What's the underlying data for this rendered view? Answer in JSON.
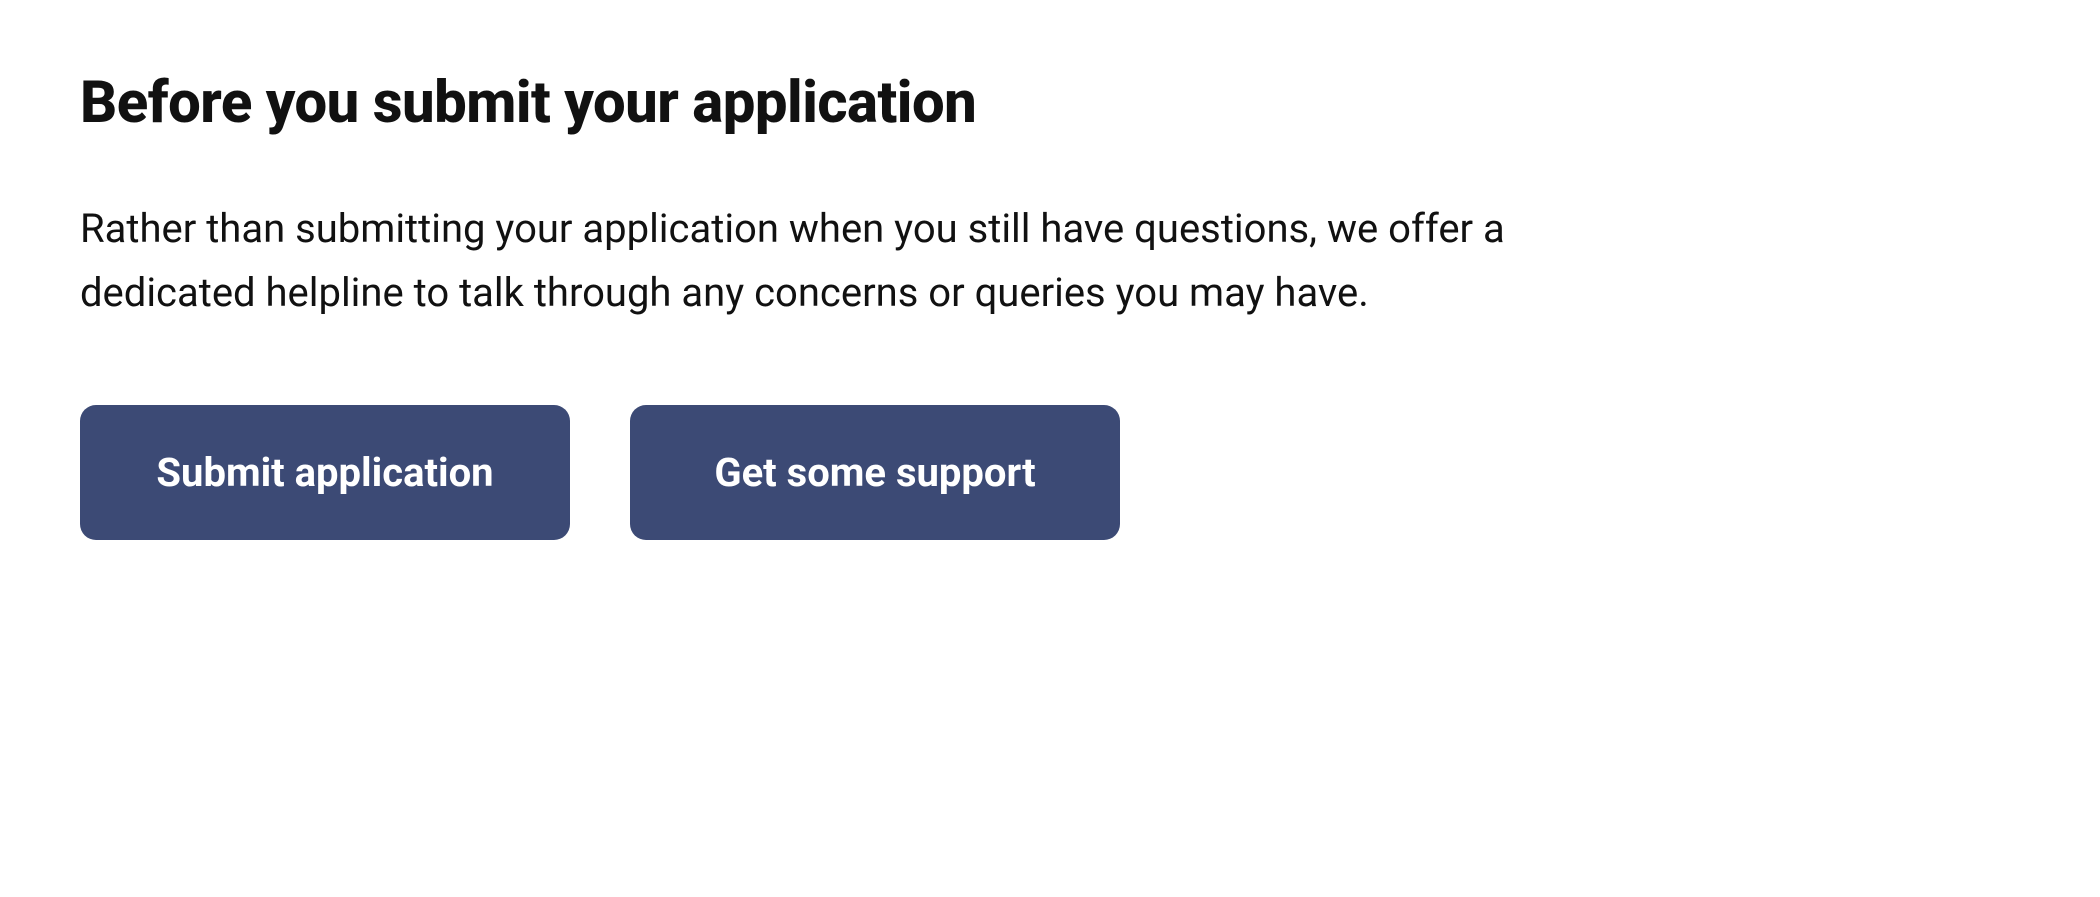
{
  "heading": "Before you submit your application",
  "description": "Rather than submitting your application when you still have questions, we offer a dedicated helpline to talk through any concerns or queries you may have.",
  "buttons": {
    "submit": "Submit application",
    "support": "Get some support"
  }
}
